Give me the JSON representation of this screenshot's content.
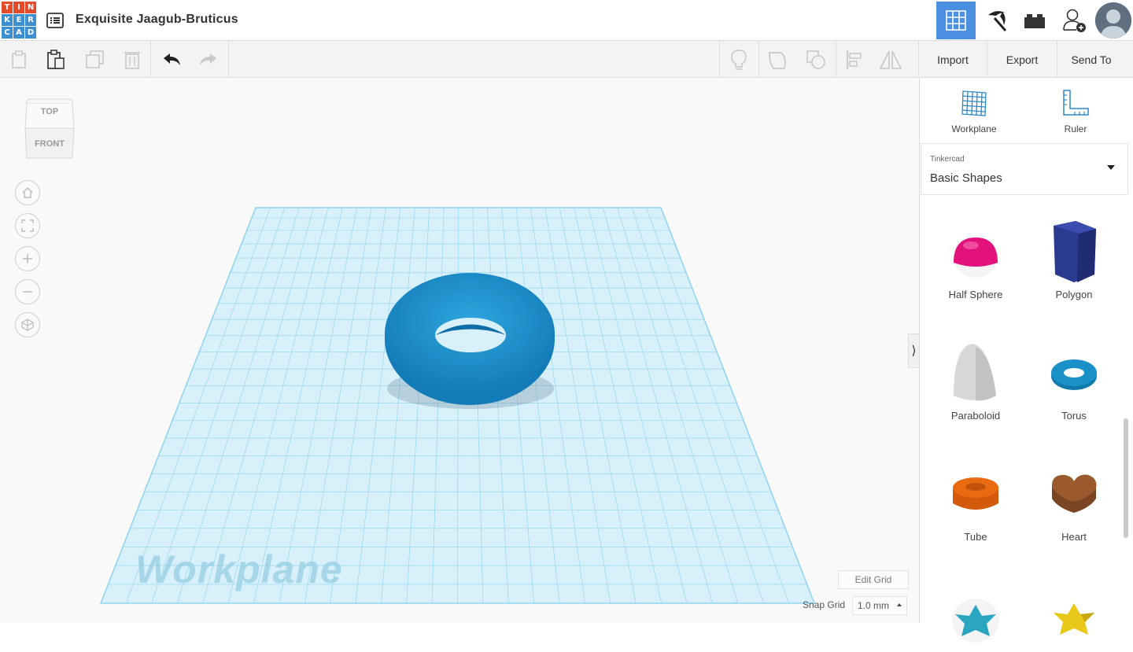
{
  "header": {
    "logo_letters": [
      "T",
      "I",
      "N",
      "K",
      "E",
      "R",
      "C",
      "A",
      "D"
    ],
    "logo_colors": [
      "#e44b2a",
      "#e44b2a",
      "#e44b2a",
      "#3c8fd0",
      "#3c8fd0",
      "#3c8fd0",
      "#3c8fd0",
      "#3c8fd0",
      "#3c8fd0"
    ],
    "title": "Exquisite Jaagub-Bruticus",
    "buttons": [
      {
        "name": "3d-design-view-button",
        "icon": "grid-icon",
        "active": true
      },
      {
        "name": "blocks-view-button",
        "icon": "pickaxe-icon",
        "active": false
      },
      {
        "name": "bricks-view-button",
        "icon": "brick-icon",
        "active": false
      },
      {
        "name": "invite-user-button",
        "icon": "add-user-icon",
        "active": false
      }
    ],
    "accent_color": "#4a8fe0"
  },
  "toolbar": {
    "left_icons": [
      "copy-icon",
      "paste-icon",
      "duplicate-icon",
      "delete-icon",
      "undo-icon",
      "redo-icon"
    ],
    "right_icons": [
      "light-bulb-icon",
      "group-icon",
      "ungroup-icon",
      "align-icon",
      "mirror-icon"
    ],
    "import_label": "Import",
    "export_label": "Export",
    "send_to_label": "Send To"
  },
  "viewcube": {
    "top_label": "TOP",
    "front_label": "FRONT"
  },
  "view_controls": [
    "home-icon",
    "fit-view-icon",
    "zoom-in-icon",
    "zoom-out-icon",
    "perspective-icon"
  ],
  "workplane": {
    "label": "Workplane",
    "grid_color": "#8fd3ee",
    "object": {
      "shape": "Torus",
      "color": "#1e8ac6"
    }
  },
  "grid_controls": {
    "edit_grid_label": "Edit Grid",
    "snap_grid_label": "Snap Grid",
    "snap_grid_value": "1.0 mm"
  },
  "panel": {
    "tools": [
      {
        "label": "Workplane",
        "icon": "workplane-icon"
      },
      {
        "label": "Ruler",
        "icon": "ruler-icon"
      }
    ],
    "library": {
      "provider": "Tinkercad",
      "selected": "Basic Shapes"
    },
    "shapes": [
      {
        "name": "Half Sphere",
        "color": "#e3117c"
      },
      {
        "name": "Polygon",
        "color": "#2a3a8e"
      },
      {
        "name": "Paraboloid",
        "color": "#d8d8d8"
      },
      {
        "name": "Torus",
        "color": "#1a90c8"
      },
      {
        "name": "Tube",
        "color": "#ea6a12"
      },
      {
        "name": "Heart",
        "color": "#9a5a2e"
      },
      {
        "name": "",
        "color": "#2aa6c0"
      },
      {
        "name": "",
        "color": "#e8c818"
      }
    ]
  }
}
